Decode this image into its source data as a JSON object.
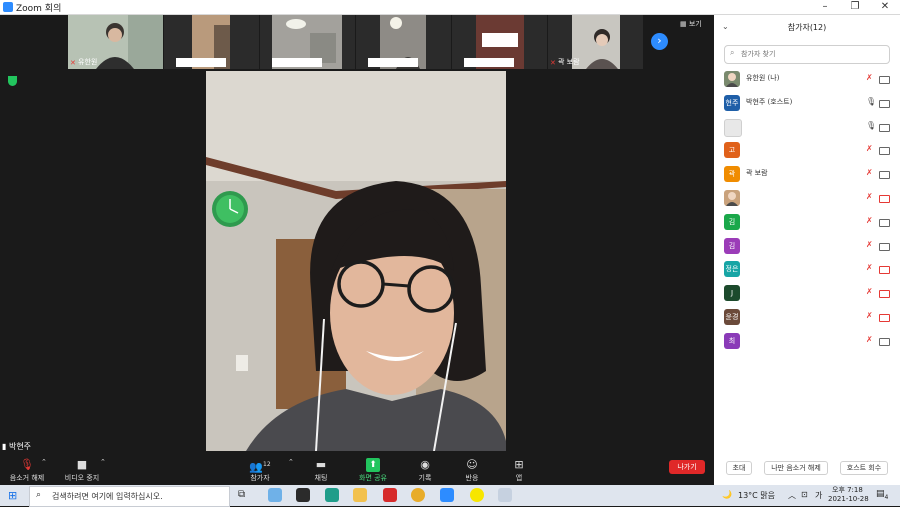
{
  "window": {
    "title": "Zoom 회의",
    "min": "–",
    "max": "❐",
    "close": "✕"
  },
  "strip": {
    "thumbs": [
      {
        "name": "유한원",
        "muted": true
      },
      {
        "name": "",
        "muted": false
      },
      {
        "name": "",
        "muted": false
      },
      {
        "name": "",
        "muted": false
      },
      {
        "name": "",
        "muted": false
      },
      {
        "name": "곽 보람",
        "muted": true
      }
    ],
    "next": "›",
    "view_label": "보기"
  },
  "speaker": {
    "name": "박현주"
  },
  "controls": [
    {
      "id": "mute",
      "icon": "mic-off-icon",
      "glyph": "🎙",
      "label": "음소거 해제",
      "caret": true
    },
    {
      "id": "video",
      "icon": "video-camera-icon",
      "glyph": "■",
      "label": "비디오 중지",
      "caret": true
    },
    {
      "id": "participants",
      "icon": "participants-icon",
      "glyph": "👥",
      "label": "참가자",
      "count": "12",
      "caret": true
    },
    {
      "id": "chat",
      "icon": "chat-icon",
      "glyph": "▬",
      "label": "채팅",
      "caret": false
    },
    {
      "id": "share",
      "icon": "share-screen-icon",
      "glyph": "⬆",
      "label": "화면 공유",
      "caret": true
    },
    {
      "id": "record",
      "icon": "record-icon",
      "glyph": "◉",
      "label": "기록",
      "caret": false
    },
    {
      "id": "reactions",
      "icon": "reaction-icon",
      "glyph": "☺",
      "label": "반응",
      "caret": false
    },
    {
      "id": "apps",
      "icon": "apps-icon",
      "glyph": "⊞",
      "label": "앱",
      "caret": false
    }
  ],
  "leave_label": "나가기",
  "panel": {
    "title": "참가자(12)",
    "collapse": "⌄",
    "search_placeholder": "참가자 찾기",
    "participants": [
      {
        "initials": "",
        "name": "유한원 (나)",
        "color": "#7a8a6e",
        "photo": true,
        "mic": "off",
        "cam": "on"
      },
      {
        "initials": "현주",
        "name": "박현주 (호스트)",
        "color": "#1f5fa8",
        "photo": false,
        "mic": "on",
        "cam": "on"
      },
      {
        "initials": "",
        "name": "",
        "color": "#e8e8e8",
        "photo": false,
        "mic": "on",
        "cam": "on"
      },
      {
        "initials": "고",
        "name": "",
        "color": "#e0611a",
        "photo": false,
        "mic": "off",
        "cam": "on"
      },
      {
        "initials": "곽",
        "name": "곽 보람",
        "color": "#f08c00",
        "photo": false,
        "mic": "off",
        "cam": "on"
      },
      {
        "initials": "",
        "name": "",
        "color": "#c9a27c",
        "photo": true,
        "mic": "off",
        "cam": "off"
      },
      {
        "initials": "김",
        "name": "",
        "color": "#1aa84a",
        "photo": false,
        "mic": "off",
        "cam": "on"
      },
      {
        "initials": "김",
        "name": "",
        "color": "#9b3cb8",
        "photo": false,
        "mic": "off",
        "cam": "on"
      },
      {
        "initials": "정은",
        "name": "",
        "color": "#17a5a5",
        "photo": false,
        "mic": "off",
        "cam": "off"
      },
      {
        "initials": "J",
        "name": "",
        "color": "#1c4a2c",
        "photo": false,
        "mic": "off",
        "cam": "off"
      },
      {
        "initials": "윤경",
        "name": "",
        "color": "#6b4a3a",
        "photo": false,
        "mic": "off",
        "cam": "off"
      },
      {
        "initials": "최",
        "name": "",
        "color": "#8a3ab8",
        "photo": false,
        "mic": "off",
        "cam": "on"
      }
    ],
    "buttons": {
      "invite": "초대",
      "mute_all": "나만 음소거 해제",
      "reclaim_host": "호스트 회수"
    }
  },
  "taskbar": {
    "search_text": "검색하려면 여기에 입력하십시오.",
    "weather": "13°C 맑음",
    "lang": "가",
    "time": "오후 7:18",
    "date": "2021-10-28",
    "notif_count": "4"
  }
}
